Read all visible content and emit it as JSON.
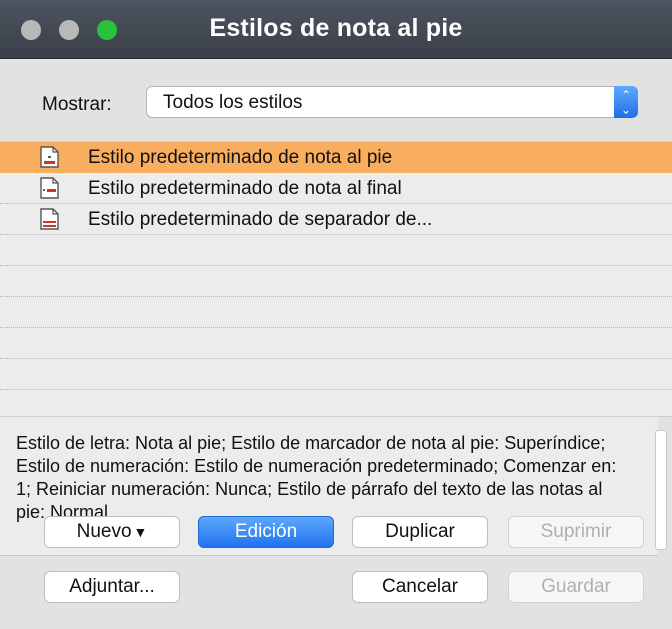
{
  "window": {
    "title": "Estilos de nota al pie"
  },
  "filter": {
    "label": "Mostrar:",
    "selected": "Todos los estilos"
  },
  "styles": [
    {
      "label": "Estilo predeterminado de nota al pie",
      "selected": true,
      "icon": "footnote-style-icon"
    },
    {
      "label": "Estilo predeterminado de nota al final",
      "selected": false,
      "icon": "endnote-style-icon"
    },
    {
      "label": "Estilo predeterminado de separador de...",
      "selected": false,
      "icon": "separator-style-icon"
    }
  ],
  "description": "Estilo de letra: Nota al pie;   Estilo de marcador de nota al pie: Superíndice;   Estilo de numeración: Estilo de numeración predeterminado;   Comenzar en: 1; Reiniciar numeración: Nunca;   Estilo de párrafo del texto de las notas al pie: Normal",
  "buttons": {
    "nuevo": "Nuevo",
    "nuevo_caret": "▼",
    "edicion": "Edición",
    "duplicar": "Duplicar",
    "suprimir": "Suprimir",
    "adjuntar": "Adjuntar...",
    "cancelar": "Cancelar",
    "guardar": "Guardar"
  },
  "colors": {
    "selection": "#f8ad5f",
    "accent": "#1f72ee",
    "titlebar": "#3f444d"
  }
}
